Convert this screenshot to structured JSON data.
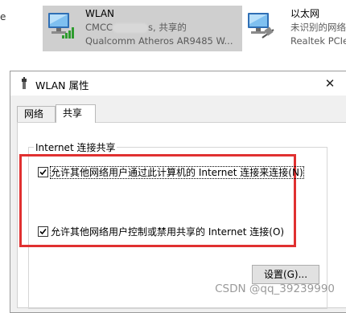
{
  "connections_strip": {
    "left_fragment": "e",
    "wlan": {
      "name": "WLAN",
      "status_prefix": "CMCC",
      "status_suffix": "s, 共享的",
      "adapter": "Qualcomm Atheros AR9485 W..."
    },
    "ethernet": {
      "name": "以太网",
      "status": "未识别的网络",
      "adapter": "Realtek PCIe"
    }
  },
  "dialog": {
    "title": "WLAN 属性",
    "close_glyph": "✕",
    "tabs": [
      {
        "label": "网络",
        "active": false
      },
      {
        "label": "共享",
        "active": true
      }
    ],
    "group_title": "Internet 连接共享",
    "options": [
      {
        "label_main": "允许其他网络用户通过此计算机的 Internet 连接来连接",
        "mnemonic": "(N)",
        "checked": true
      },
      {
        "label_main": "允许其他网络用户控制或禁用共享的 Internet 连接",
        "mnemonic": "(O)",
        "checked": true
      }
    ],
    "settings_button": "设置(G)..."
  },
  "watermark": "CSDN @qq_39239990",
  "colors": {
    "highlight_border": "#e03030",
    "selected_bg": "#cfcfcf",
    "signal_green": "#2e9b2e"
  },
  "icons": {
    "wlan": "wireless-computer-icon",
    "ethernet": "wired-network-computer-icon",
    "title": "wifi-adapter-icon"
  }
}
